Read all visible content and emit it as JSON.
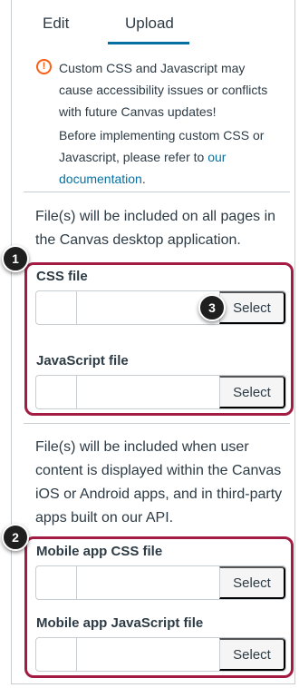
{
  "tabs": [
    {
      "label": "Edit"
    },
    {
      "label": "Upload"
    }
  ],
  "warning": {
    "text": "Custom CSS and Javascript may cause accessibility issues or conflicts with future Canvas updates!",
    "refer_text": "Before implementing custom CSS or Javascript, please refer to ",
    "link_text": "our documentation",
    "period": "."
  },
  "desktop": {
    "description": "File(s) will be included on all pages in the Canvas desktop application.",
    "css_label": "CSS file",
    "js_label": "JavaScript file",
    "select_label": "Select"
  },
  "mobile": {
    "description": "File(s) will be included when user content is displayed within the Canvas iOS or Android apps, and in third-party apps built on our API.",
    "css_label": "Mobile app CSS file",
    "js_label": "Mobile app JavaScript file",
    "select_label": "Select"
  },
  "badges": [
    "1",
    "2",
    "3"
  ],
  "colors": {
    "accent": "#0770a3",
    "highlight": "#a31b43",
    "warning": "#fc5e13"
  },
  "icons": {
    "warning": "warning-icon"
  }
}
